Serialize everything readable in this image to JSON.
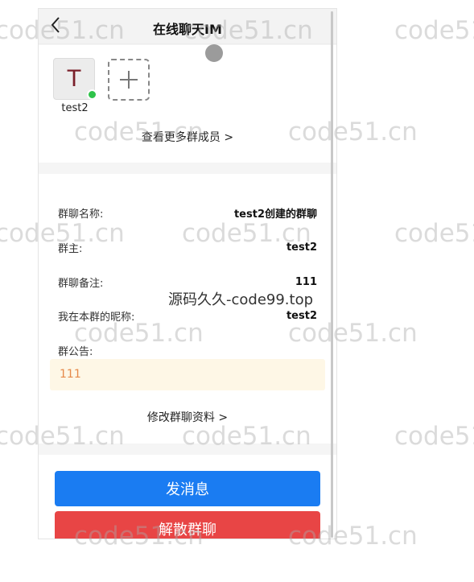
{
  "header": {
    "title": "在线聊天IM",
    "back_icon": "chevron-left-icon"
  },
  "members": {
    "list": [
      {
        "avatar_letter": "T",
        "name": "test2",
        "online": true
      }
    ],
    "add_icon": "plus-icon",
    "more_label": "查看更多群成员 >"
  },
  "info": {
    "group_name_label": "群聊名称:",
    "group_name_value": "test2创建的群聊",
    "owner_label": "群主:",
    "owner_value": "test2",
    "remark_label": "群聊备注:",
    "remark_value": "111",
    "nickname_label": "我在本群的昵称:",
    "nickname_value": "test2",
    "notice_label": "群公告:",
    "notice_value": "111",
    "edit_label": "修改群聊资料 >"
  },
  "actions": {
    "send_label": "发消息",
    "dissolve_label": "解散群聊"
  },
  "overlay": "源码久久-code99.top",
  "watermark": "code51.cn",
  "colors": {
    "primary": "#1a7cf2",
    "danger": "#e84545",
    "online": "#2fc34a",
    "notice_bg": "#fef7e6"
  }
}
